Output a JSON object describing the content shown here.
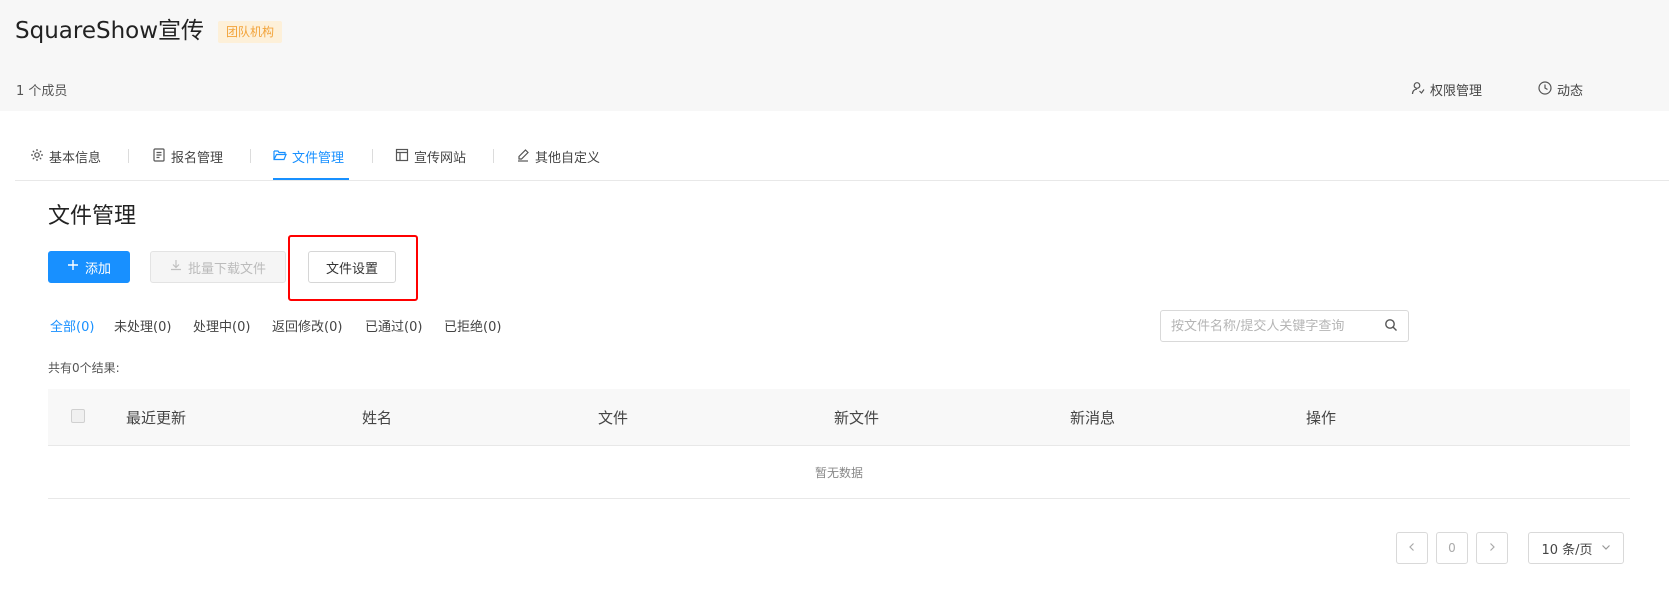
{
  "header": {
    "title": "SquareShow宣传",
    "badge": "团队机构",
    "members": "1 个成员",
    "links": [
      {
        "label": "权限管理",
        "icon": "user-permission-icon"
      },
      {
        "label": "动态",
        "icon": "clock-icon"
      }
    ]
  },
  "tabs": [
    {
      "label": "基本信息",
      "icon": "gear-icon",
      "active": false
    },
    {
      "label": "报名管理",
      "icon": "form-icon",
      "active": false
    },
    {
      "label": "文件管理",
      "icon": "folder-open-icon",
      "active": true
    },
    {
      "label": "宣传网站",
      "icon": "layout-icon",
      "active": false
    },
    {
      "label": "其他自定义",
      "icon": "edit-icon",
      "active": false
    }
  ],
  "section": {
    "title": "文件管理"
  },
  "toolbar": {
    "add_label": "添加",
    "batch_download_label": "批量下载文件",
    "file_settings_label": "文件设置"
  },
  "filters": [
    {
      "label": "全部(0)",
      "active": true
    },
    {
      "label": "未处理(0)",
      "active": false
    },
    {
      "label": "处理中(0)",
      "active": false
    },
    {
      "label": "返回修改(0)",
      "active": false
    },
    {
      "label": "已通过(0)",
      "active": false
    },
    {
      "label": "已拒绝(0)",
      "active": false
    }
  ],
  "search": {
    "placeholder": "按文件名称/提交人关键字查询",
    "value": ""
  },
  "result_count": "共有0个结果:",
  "table": {
    "columns": [
      "最近更新",
      "姓名",
      "文件",
      "新文件",
      "新消息",
      "操作"
    ],
    "empty_text": "暂无数据"
  },
  "pagination": {
    "current_page": "0",
    "page_size_label": "10 条/页"
  },
  "colors": {
    "primary": "#1890ff",
    "badge_bg": "#fdf0d9",
    "badge_text": "#f2a33a",
    "highlight": "#ff0000"
  }
}
